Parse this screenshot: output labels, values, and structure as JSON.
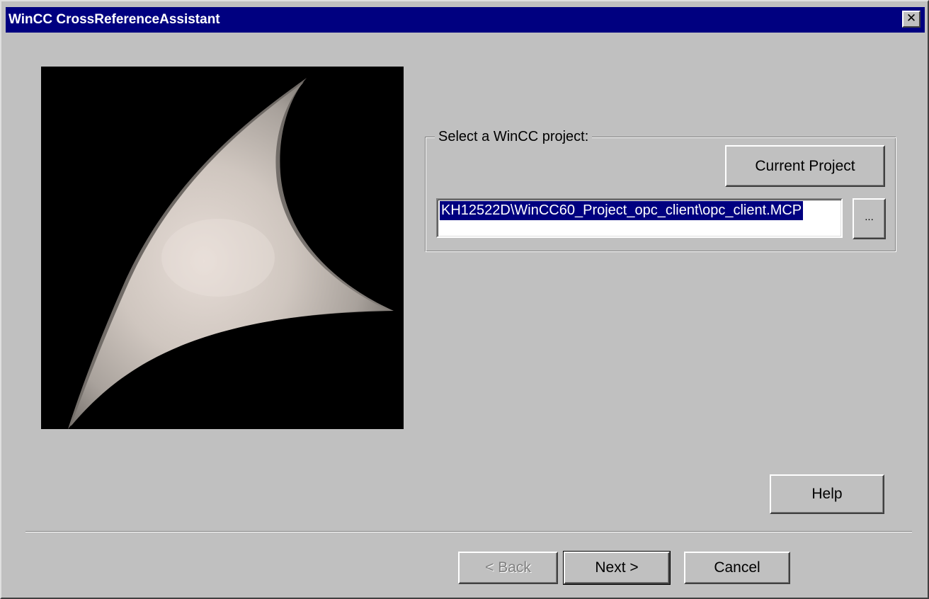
{
  "window": {
    "title": "WinCC CrossReferenceAssistant",
    "close_glyph": "✕"
  },
  "wizard_image": {
    "icon": "curved-sail-graphic"
  },
  "project_group": {
    "label": "Select a WinCC project:",
    "current_project_label": "Current Project",
    "path_value": "KH12522D\\WinCC60_Project_opc_client\\opc_client.MCP",
    "browse_label": "..."
  },
  "buttons": {
    "help": "Help",
    "back": "< Back",
    "next": "Next >",
    "cancel": "Cancel"
  },
  "colors": {
    "title_bar": "#000080",
    "dialog_face": "#c0c0c0",
    "selection": "#000080"
  }
}
